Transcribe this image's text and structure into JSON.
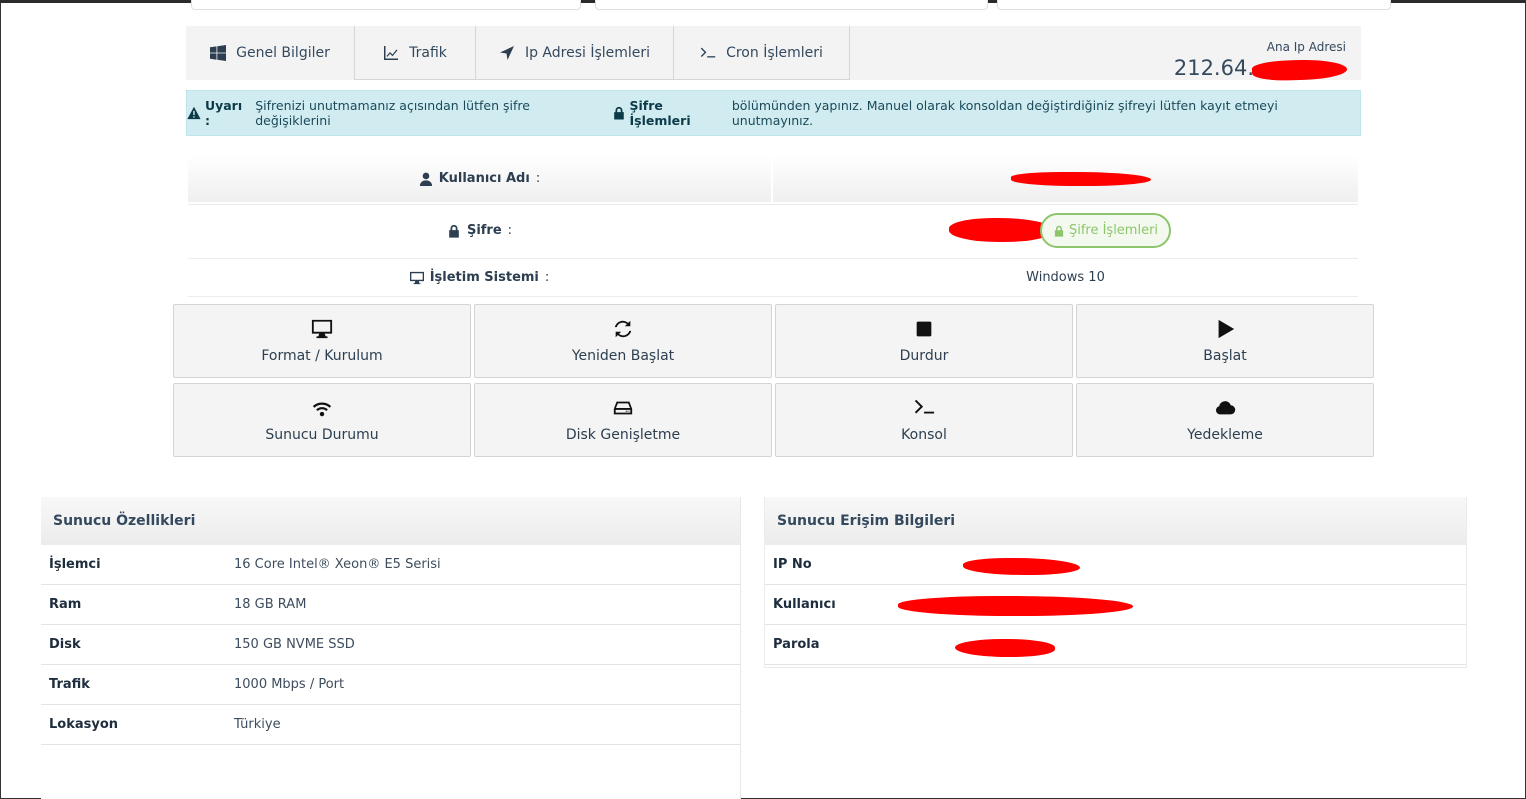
{
  "tabs": [
    {
      "label": "Genel Bilgiler",
      "icon": "windows-icon"
    },
    {
      "label": "Trafik",
      "icon": "chart-line-icon"
    },
    {
      "label": "Ip Adresi İşlemleri",
      "icon": "location-arrow-icon"
    },
    {
      "label": "Cron İşlemleri",
      "icon": "terminal-icon"
    }
  ],
  "ip": {
    "label": "Ana Ip Adresi",
    "value": "212.64."
  },
  "alert": {
    "strong": "Uyarı :",
    "text1": "Şifrenizi unutmamanız açısından lütfen şifre değişiklerini",
    "link": "Şifre İşlemleri",
    "text2": "bölümünden yapınız. Manuel olarak konsoldan değiştirdiğiniz şifreyi lütfen kayıt etmeyi unutmayınız."
  },
  "info": {
    "username_label": "Kullanıcı Adı",
    "password_label": "Şifre",
    "os_label": "İşletim Sistemi",
    "os_value": "Windows 10",
    "colon": ":",
    "password_button": "Şifre İşlemleri"
  },
  "actions": [
    {
      "label": "Format / Kurulum",
      "icon": "desktop-icon"
    },
    {
      "label": "Yeniden Başlat",
      "icon": "sync-icon"
    },
    {
      "label": "Durdur",
      "icon": "stop-icon"
    },
    {
      "label": "Başlat",
      "icon": "play-icon"
    },
    {
      "label": "Sunucu Durumu",
      "icon": "wifi-icon"
    },
    {
      "label": "Disk Genişletme",
      "icon": "hdd-icon"
    },
    {
      "label": "Konsol",
      "icon": "terminal-icon"
    },
    {
      "label": "Yedekleme",
      "icon": "cloud-icon"
    }
  ],
  "specs": {
    "title": "Sunucu Özellikleri",
    "rows": [
      {
        "key": "İşlemci",
        "value": "16 Core Intel® Xeon® E5 Serisi"
      },
      {
        "key": "Ram",
        "value": "18 GB RAM"
      },
      {
        "key": "Disk",
        "value": "150 GB NVME SSD"
      },
      {
        "key": "Trafik",
        "value": "1000 Mbps / Port"
      },
      {
        "key": "Lokasyon",
        "value": "Türkiye"
      }
    ]
  },
  "access": {
    "title": "Sunucu Erişim Bilgileri",
    "rows": [
      {
        "key": "IP No"
      },
      {
        "key": "Kullanıcı"
      },
      {
        "key": "Parola"
      }
    ]
  },
  "colors": {
    "alert_bg": "#d1ecf1",
    "success": "#8cc56a",
    "redaction": "#ff0000"
  }
}
